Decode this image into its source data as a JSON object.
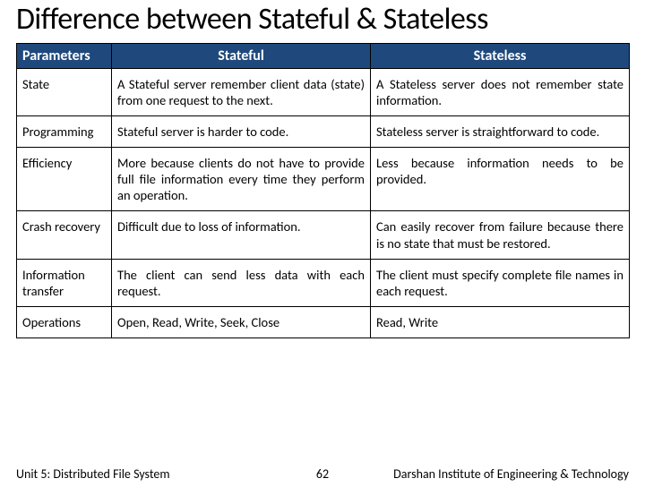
{
  "title": "Difference between Stateful & Stateless",
  "headers": {
    "param": "Parameters",
    "stateful": "Stateful",
    "stateless": "Stateless"
  },
  "rows": [
    {
      "param": "State",
      "stateful": "A Stateful server remember client data (state) from one request to the next.",
      "stateless": "A Stateless server does not remember state information."
    },
    {
      "param": "Programming",
      "stateful": "Stateful server is harder to code.",
      "stateless": "Stateless server is straightforward to code."
    },
    {
      "param": "Efficiency",
      "stateful": "More because clients do not have to provide full file information every time they perform an operation.",
      "stateless": "Less because information needs to be provided."
    },
    {
      "param": "Crash recovery",
      "stateful": "Difficult due to loss of information.",
      "stateless": "Can easily recover from failure because there is no state that must be restored."
    },
    {
      "param": "Information transfer",
      "stateful": "The client can send less data with each request.",
      "stateless": "The client must specify complete file names in each request."
    },
    {
      "param": "Operations",
      "stateful": "Open, Read, Write, Seek, Close",
      "stateless": "Read, Write"
    }
  ],
  "footer": {
    "unit": "Unit 5: Distributed File System",
    "page": "62",
    "inst": "Darshan Institute of Engineering & Technology"
  }
}
